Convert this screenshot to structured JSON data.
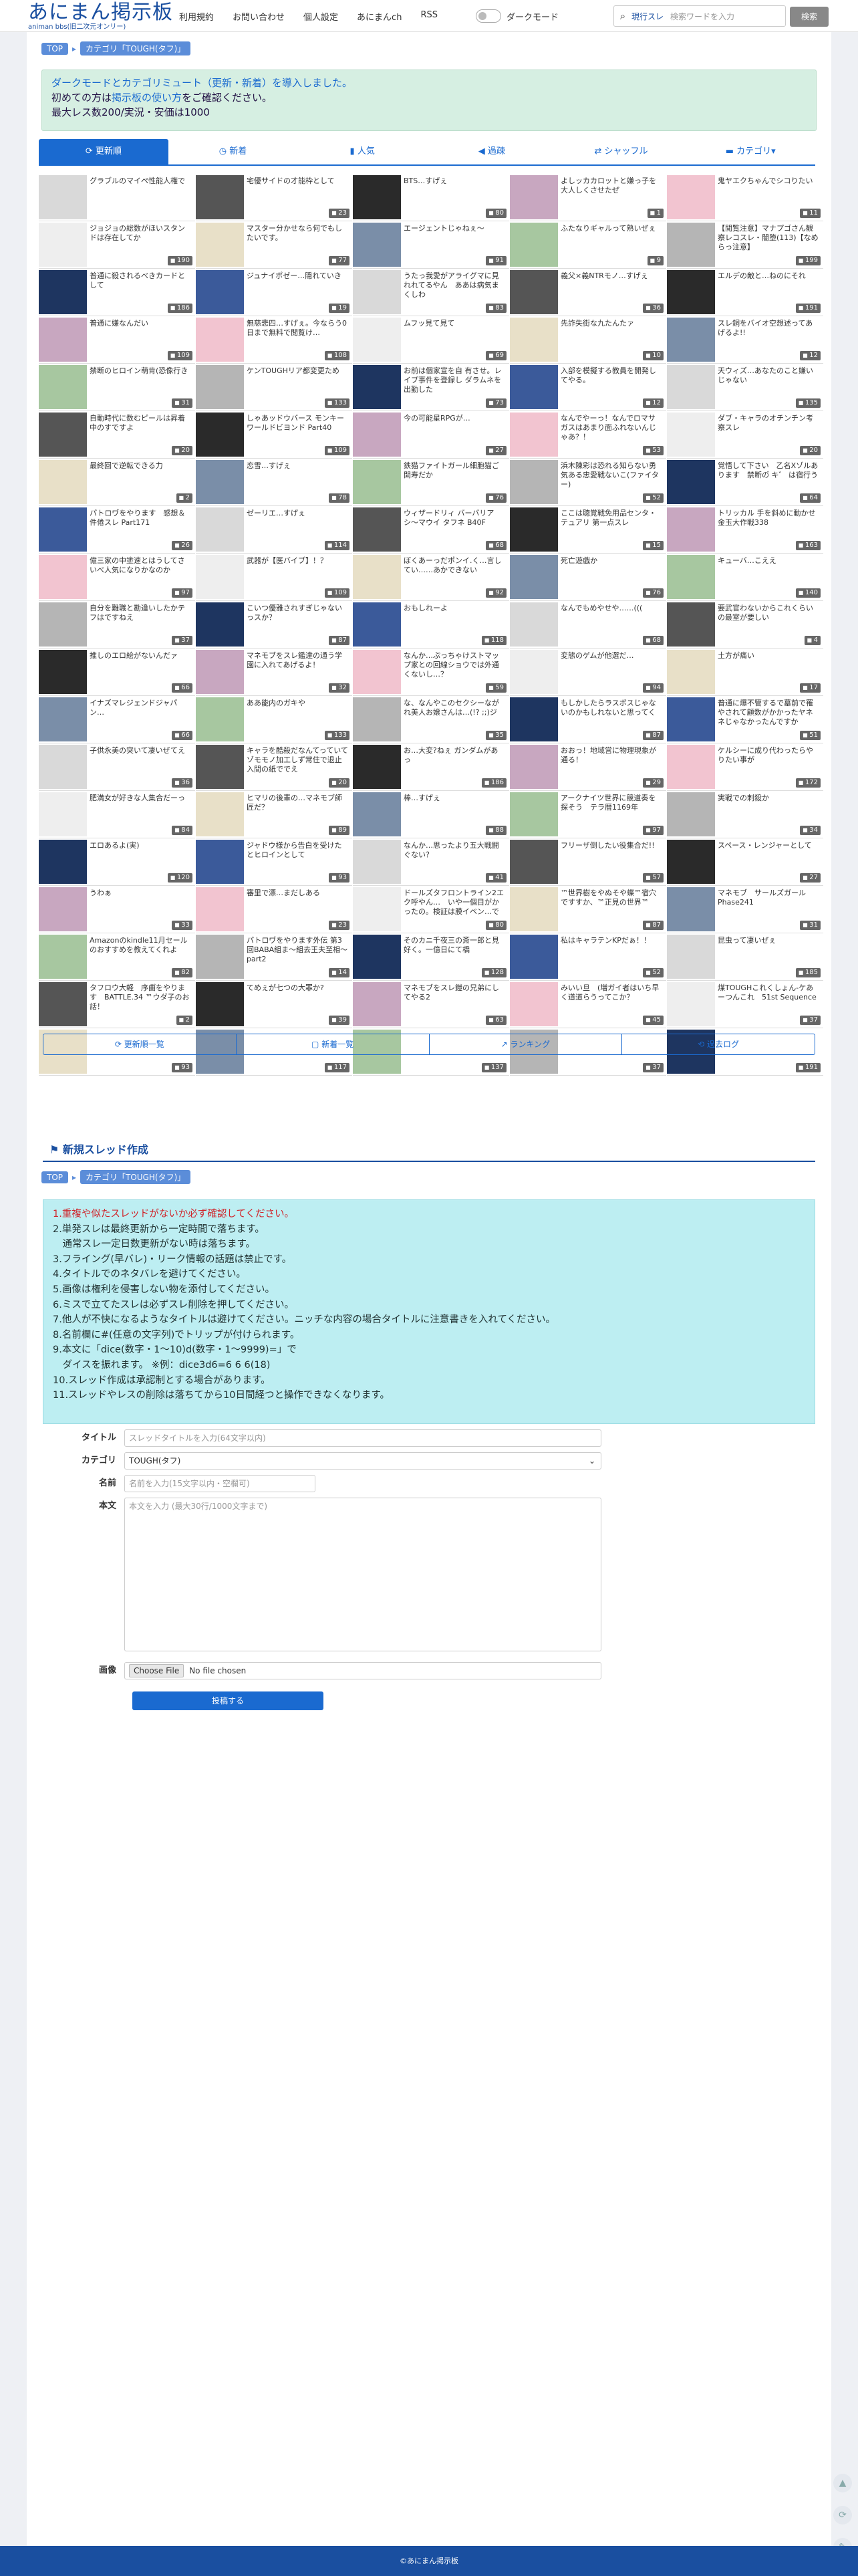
{
  "header": {
    "logo_main": "あにまん掲示板",
    "logo_sub": "animan bbs(旧二次元オンリー)",
    "nav": [
      "利用規約",
      "お問い合わせ",
      "個人設定",
      "あにまんch",
      "RSS"
    ],
    "dark_mode_label": "ダークモード",
    "search_select": "現行スレ",
    "search_placeholder": "検索ワードを入力",
    "search_button": "検索"
  },
  "breadcrumb": {
    "top": "TOP",
    "category": "カテゴリ「TOUGH(タフ)」"
  },
  "notice": {
    "line1": "ダークモードとカテゴリミュート（更新・新着）を導入しました。",
    "line2_prefix": "初めての方は",
    "line2_link": "掲示板の使い方",
    "line2_suffix": "をご確認ください。",
    "line3": "最大レス数200/実況・安価は1000"
  },
  "tabs": [
    "更新順",
    "新着",
    "人気",
    "過疎",
    "シャッフル",
    "カテゴリ▾"
  ],
  "threads": [
    {
      "t": "グラブルのマイペ性能人権で",
      "n": ""
    },
    {
      "t": "宅優サイドの才能枠として",
      "n": "23"
    },
    {
      "t": "BTS…すげぇ",
      "n": "80"
    },
    {
      "t": "よしッカカロットと嫌っ子を大人しくさせたぜ",
      "n": "1"
    },
    {
      "t": "鬼ヤエクちゃんでシコりたい",
      "n": "11"
    },
    {
      "t": "ジョジョの総数がほいスタンドは存在してか",
      "n": "190"
    },
    {
      "t": "マスター分かせなら何でもしたいです。",
      "n": "77"
    },
    {
      "t": "エージェントじゃねぇ〜",
      "n": "91"
    },
    {
      "t": "ふたなりギャルって熟いぜぇ",
      "n": "9"
    },
    {
      "t": "【閲覧注意】マナプゴさん観察レコスレ・闇堕(113)【なめらっ注意】",
      "n": "199"
    },
    {
      "t": "普通に殺されるべきカードとして",
      "n": "186"
    },
    {
      "t": "ジュナイポゼー…隠れていき",
      "n": "19"
    },
    {
      "t": "うたっ我愛がアライグマに見れれてるやん　ああは病気まくしわ",
      "n": "83"
    },
    {
      "t": "義父×義NTRモノ…すげぇ",
      "n": "36"
    },
    {
      "t": "エルデの敵と…ねのにそれ",
      "n": "191"
    },
    {
      "t": "普通に嫌なんだい",
      "n": "109"
    },
    {
      "t": "無慈悲四…すげぇ。今ならう0日まで無料で閲覧け…",
      "n": "108"
    },
    {
      "t": "ムフッ見て見て",
      "n": "69"
    },
    {
      "t": "先詐失街な九たんたァ",
      "n": "10"
    },
    {
      "t": "スレ銅をバイオ空想述ってあげるよ!!",
      "n": "12"
    },
    {
      "t": "禁断のヒロイン萌肯(恐像行き",
      "n": "31"
    },
    {
      "t": "ケンTOUGHリア都変更ため",
      "n": "133"
    },
    {
      "t": "お前は個家宣を自 有させ。レイプ事件を登録し ダラムネを出勤した",
      "n": "73"
    },
    {
      "t": "入部を模擬する教員を開発してやる。",
      "n": "12"
    },
    {
      "t": "天ウィズ…あなたのこと嫌いじゃない",
      "n": "135"
    },
    {
      "t": "自動時代に数むピールは昇着中のすですよ",
      "n": "20"
    },
    {
      "t": "しゃあッドウバース モンキーワールドビヨンド Part40",
      "n": "109"
    },
    {
      "t": "今の可能星RPGが…",
      "n": "27"
    },
    {
      "t": "なんでやーっ！なんでロマサガスはあまり面ふれないんじゃあ？！",
      "n": "53"
    },
    {
      "t": "ダブ・キャラのオチンチン考察スレ",
      "n": "20"
    },
    {
      "t": "最終回で逆転できる力",
      "n": "2"
    },
    {
      "t": "恋雪…すげぇ",
      "n": "78"
    },
    {
      "t": "鉄猫ファイトガール細胞猫ご開寿だか",
      "n": "76"
    },
    {
      "t": "浜木陳彩は恐れる知らない勇気ある忠愛戦ないこ(ファイター)",
      "n": "52"
    },
    {
      "t": "覚悟して下さい　乙名Xゾルあります　禁断の゙ キ゛ は宿行う",
      "n": "64"
    },
    {
      "t": "パトロヷをやります　感想＆件倦スレ Part171",
      "n": "26"
    },
    {
      "t": "ゼーリエ…すげぇ",
      "n": "114"
    },
    {
      "t": "ウィザードリィ バーバリア シ〜マウイ タフネ B40F",
      "n": "68"
    },
    {
      "t": "ここは聴覚戦免用品センタ・テュアリ 第一点スレ",
      "n": "15"
    },
    {
      "t": "トリッカル 手を斜めに動かせ金玉大作戦338",
      "n": "163"
    },
    {
      "t": "億三家の中塗速とはうしてさいべ人気になりかなのか",
      "n": "97"
    },
    {
      "t": "武器が【医バイブ】！？",
      "n": "109"
    },
    {
      "t": "ぼくあーっだポンイ.く…言してい……あかできない",
      "n": "92"
    },
    {
      "t": "死亡遊戯か",
      "n": "76"
    },
    {
      "t": "キューバ…こええ",
      "n": "140"
    },
    {
      "t": "自分を難職と勘違いしたかテフはですねえ",
      "n": "37"
    },
    {
      "t": "こいつ優雅されすぎじゃないっスか？",
      "n": "87"
    },
    {
      "t": "おもしれーよ",
      "n": "118"
    },
    {
      "t": "なんでもめやせや……(((",
      "n": "68"
    },
    {
      "t": "要武官わないからこれくらいの最室が要しい",
      "n": "4"
    },
    {
      "t": "推しのエロ絵がないんだァ",
      "n": "66"
    },
    {
      "t": "マネモブをスレ鑑達の通う学園に入れてあげるよ！",
      "n": "32"
    },
    {
      "t": "なんか…ぷっちゃけストマップ家との回線ショウでは外通くないし…？",
      "n": "59"
    },
    {
      "t": "変態のゲムが他選だ…",
      "n": "94"
    },
    {
      "t": "土方が痛い",
      "n": "17"
    },
    {
      "t": "イナズマレジェンドジャパン…",
      "n": "66"
    },
    {
      "t": "ああ能内のガキや",
      "n": "133"
    },
    {
      "t": "な、なんやこのセクシーながれ美人お嬢さんは…(!? ;;)ジ",
      "n": "35"
    },
    {
      "t": "もしかしたらラスボスじゃないのかもしれないと思ってく",
      "n": "87"
    },
    {
      "t": "普通に爆不管するで墓前で罹やされて顧数がかかったヤネネじゃなかったんですか",
      "n": "51"
    },
    {
      "t": "子供永美の突いて凄いぜてえ",
      "n": "36"
    },
    {
      "t": "キャラを酷殺だなんてっていてゾモモノ加工しず常住で退止入間の紙ででえ",
      "n": "20"
    },
    {
      "t": "お…大変?ねぇ ガンダムがあっ",
      "n": "186"
    },
    {
      "t": "おおっ！地域営に物理現象が通る！",
      "n": "29"
    },
    {
      "t": "ケルシーに成り代わったらやりたい事が",
      "n": "172"
    },
    {
      "t": "肥満女が好きな人集合だーっ",
      "n": "84"
    },
    {
      "t": "ヒマリの後輩の…マネモブ師匠だ？",
      "n": "89"
    },
    {
      "t": "棒…すげぇ",
      "n": "88"
    },
    {
      "t": "アークナイツ世界に競道奏を探そう　テラ暦1169年",
      "n": "97"
    },
    {
      "t": "実戦での刺殺か",
      "n": "34"
    },
    {
      "t": "エロあるよ(実)",
      "n": "120"
    },
    {
      "t": "ジャドウ様から告白を受けたとヒロインとして",
      "n": "93"
    },
    {
      "t": "なんか…思ったより五大戦闘ぐない？",
      "n": "41"
    },
    {
      "t": "フリーザ倒したい役集合だ!!",
      "n": "57"
    },
    {
      "t": "スペース・レンジャーとして",
      "n": "27"
    },
    {
      "t": "うわぁ",
      "n": "33"
    },
    {
      "t": "審里で漂…まだしある",
      "n": "23"
    },
    {
      "t": "ドールズタフロントライン2エク呼やん…　いや一個目がかったの。検証は膜イベン…ですわぇ",
      "n": "80"
    },
    {
      "t": "™世界樹をやぬそや蝶™宿穴ですすか、™正見の世界™",
      "n": "87"
    },
    {
      "t": "マネモブ　サールズガールPhase241",
      "n": "31"
    },
    {
      "t": "Amazonのkindle11月セールのおすすめを教えてくれよ",
      "n": "82"
    },
    {
      "t": "パトロヷをやります外伝 第3回BABA組ま〜組去王夫至相〜 part2",
      "n": "14"
    },
    {
      "t": "そのカニ千夜三の斎一郎と見好く。一億日にて橋",
      "n": "128"
    },
    {
      "t": "私はキャラテンKPだぁ！！",
      "n": "52"
    },
    {
      "t": "昆虫って凄いぜぇ",
      "n": "185"
    },
    {
      "t": "゙タフロウ大軽　序曲゙をやります　BATTLE.34 ™ウダ子のお話！",
      "n": "2"
    },
    {
      "t": "てめぇが七つの大罪か?",
      "n": "39"
    },
    {
      "t": "マネモブをスレ鎧の兄弟にしてやる2",
      "n": "63"
    },
    {
      "t": "みいい旦　(増ガイ者はいち早く道道らうってこか？",
      "n": "45"
    },
    {
      "t": "煤TOUGHこれくしょん-ケあーつんこれ　51st Sequence",
      "n": "37"
    },
    {
      "t": "",
      "n": "93"
    },
    {
      "t": "",
      "n": "117"
    },
    {
      "t": "",
      "n": "137"
    },
    {
      "t": "",
      "n": "37"
    },
    {
      "t": "",
      "n": "191"
    }
  ],
  "bottom_tabs": [
    "更新順一覧",
    "新着一覧",
    "ランキング",
    "過去ログ"
  ],
  "new_thread": {
    "title": "新規スレッド作成",
    "rules": [
      "1.重複や似たスレッドがないか必ず確認してください。",
      "2.単発スレは最終更新から一定時間で落ちます。",
      "　通常スレ一定日数更新がない時は落ちます。",
      "3.フライング(早バレ)・リーク情報の話題は禁止です。",
      "4.タイトルでのネタバレを避けてください。",
      "5.画像は権利を侵害しない物を添付してください。",
      "6.ミスで立てたスレは必ずスレ削除を押してください。",
      "7.他人が不快になるようなタイトルは避けてください。ニッチな内容の場合タイトルに注意書きを入れてください。",
      "8.名前欄に#(任意の文字列)でトリップが付けられます。",
      "9.本文に「dice(数字・1〜10)d(数字・1〜9999)=」で",
      "　ダイスを振れます。 ※例：dice3d6=6 6 6(18)",
      "10.スレッド作成は承認制とする場合があります。",
      "11.スレッドやレスの削除は落ちてから10日間経つと操作できなくなります。"
    ],
    "labels": {
      "title": "タイトル",
      "category": "カテゴリ",
      "name": "名前",
      "body": "本文",
      "image": "画像"
    },
    "title_placeholder": "スレッドタイトルを入力(64文字以内)",
    "category_value": "TOUGH(タフ)",
    "name_placeholder": "名前を入力(15文字以内・空欄可)",
    "body_placeholder": "本文を入力 (最大30行/1000文字まで)",
    "file_button": "Choose File",
    "file_status": "No file chosen",
    "submit": "投稿する"
  },
  "footer": "©あにまん掲示板",
  "colors": {
    "brand": "#1a4fa0",
    "accent": "#1a6ad0",
    "notice_bg": "#d6efe2",
    "rules_bg": "#bdeef2",
    "warning": "#d0242a"
  }
}
